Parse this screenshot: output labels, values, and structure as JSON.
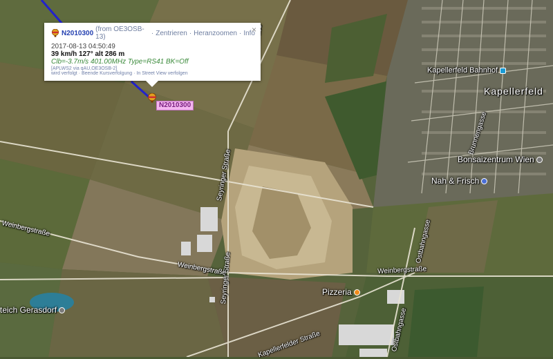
{
  "popup": {
    "station_id": "N2010300",
    "from_text": "(from OE3OSB-13)",
    "sep": "·",
    "link_center": "Zentrieren",
    "link_zoom": "Heranzoomen",
    "link_info": "Info",
    "close_symbol": "×",
    "timestamp": "2017-08-13 04:50:49",
    "speed_line": "39 km/h 127° alt 286 m",
    "comment": "Clb=-3.7m/s 401.00MHz Type=RS41 BK=Off",
    "path": "[APLWS2 via qAU,OE3OSB-2]",
    "track_status": "wird verfolgt",
    "link_stop_tracking": "Beende Kursverfolgung",
    "link_streetview": "In Street View verfolgen"
  },
  "marker": {
    "label": "N2010300",
    "icon": "balloon-icon"
  },
  "places": {
    "kapellerfeld": "Kapellerfeld",
    "kapellerfeld_bahnhof": "Kapellerfeld Bahnhof",
    "bonsaizentrum": "Bonsaizentrum Wien",
    "nah_frisch": "Nah & Frisch",
    "pizzeria": "Pizzeria",
    "teich": "teich Gerasdorf"
  },
  "roads": {
    "seyringer_1": "Seyringer Straße",
    "seyringer_2": "Seyringer Straße",
    "seyringer_3": "Seyringer Straße",
    "weinberg_1": "Weinbergstraße",
    "weinberg_2": "Weinbergstraße",
    "weinberg_3": "Weinbergstraße",
    "ostbahn_1": "Ostbahngasse",
    "ostbahn_2": "Ostbahngasse",
    "kapellerfelder": "Kapellerfelder Straße",
    "brunnengasse": "Brunnengasse"
  },
  "colors": {
    "track": "#2222cc",
    "callsign_bg": "#f3b5ef",
    "link": "#2440b0",
    "comment": "#3a8a3a"
  }
}
